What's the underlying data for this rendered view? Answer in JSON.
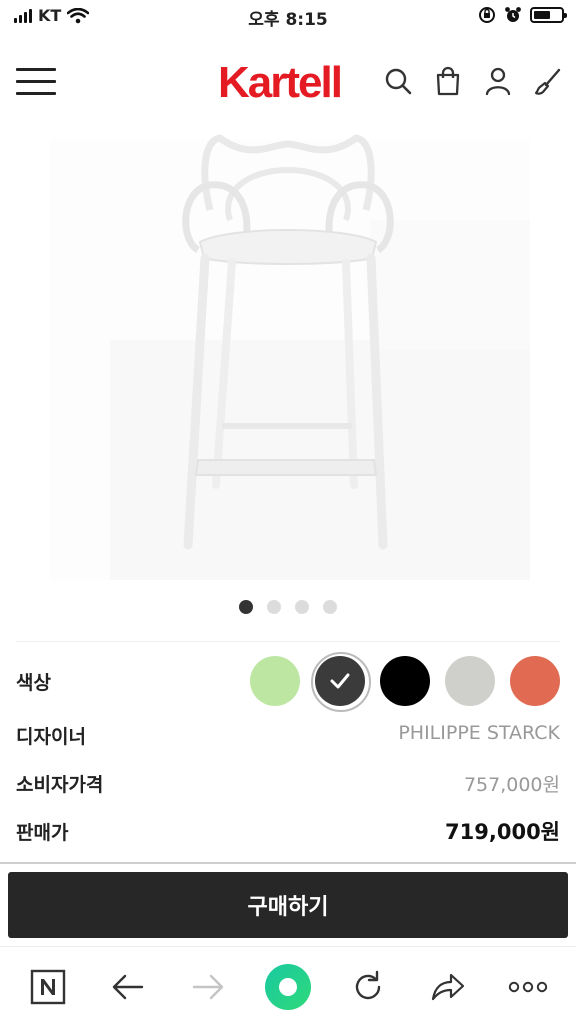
{
  "status_bar": {
    "carrier": "KT",
    "time": "오후 8:15"
  },
  "header": {
    "logo": "Kartell",
    "icons": [
      "menu-icon",
      "search-icon",
      "bag-icon",
      "user-icon",
      "brush-icon"
    ]
  },
  "gallery": {
    "dots_total": 4,
    "active_index": 0
  },
  "product": {
    "color_label": "색상",
    "colors": [
      {
        "hex": "#bde6a3",
        "selected": false
      },
      {
        "hex": "#3b3b3b",
        "selected": true
      },
      {
        "hex": "#000000",
        "selected": false
      },
      {
        "hex": "#cfcfcb",
        "selected": false
      },
      {
        "hex": "#e06b52",
        "selected": false
      }
    ],
    "designer_label": "디자이너",
    "designer_value": "PHILIPPE STARCK",
    "consumer_price_label": "소비자가격",
    "consumer_price_value": "757,000원",
    "sale_price_label": "판매가",
    "sale_price_value": "719,000원"
  },
  "buy_button": {
    "label": "구매하기"
  },
  "browser_bar": {
    "icons": [
      "naver-n-icon",
      "back-arrow-icon",
      "forward-arrow-icon",
      "home-circle-icon",
      "refresh-icon",
      "share-icon",
      "more-icon"
    ],
    "accent": "#19c9a0",
    "brand_color": "#e41b23"
  }
}
